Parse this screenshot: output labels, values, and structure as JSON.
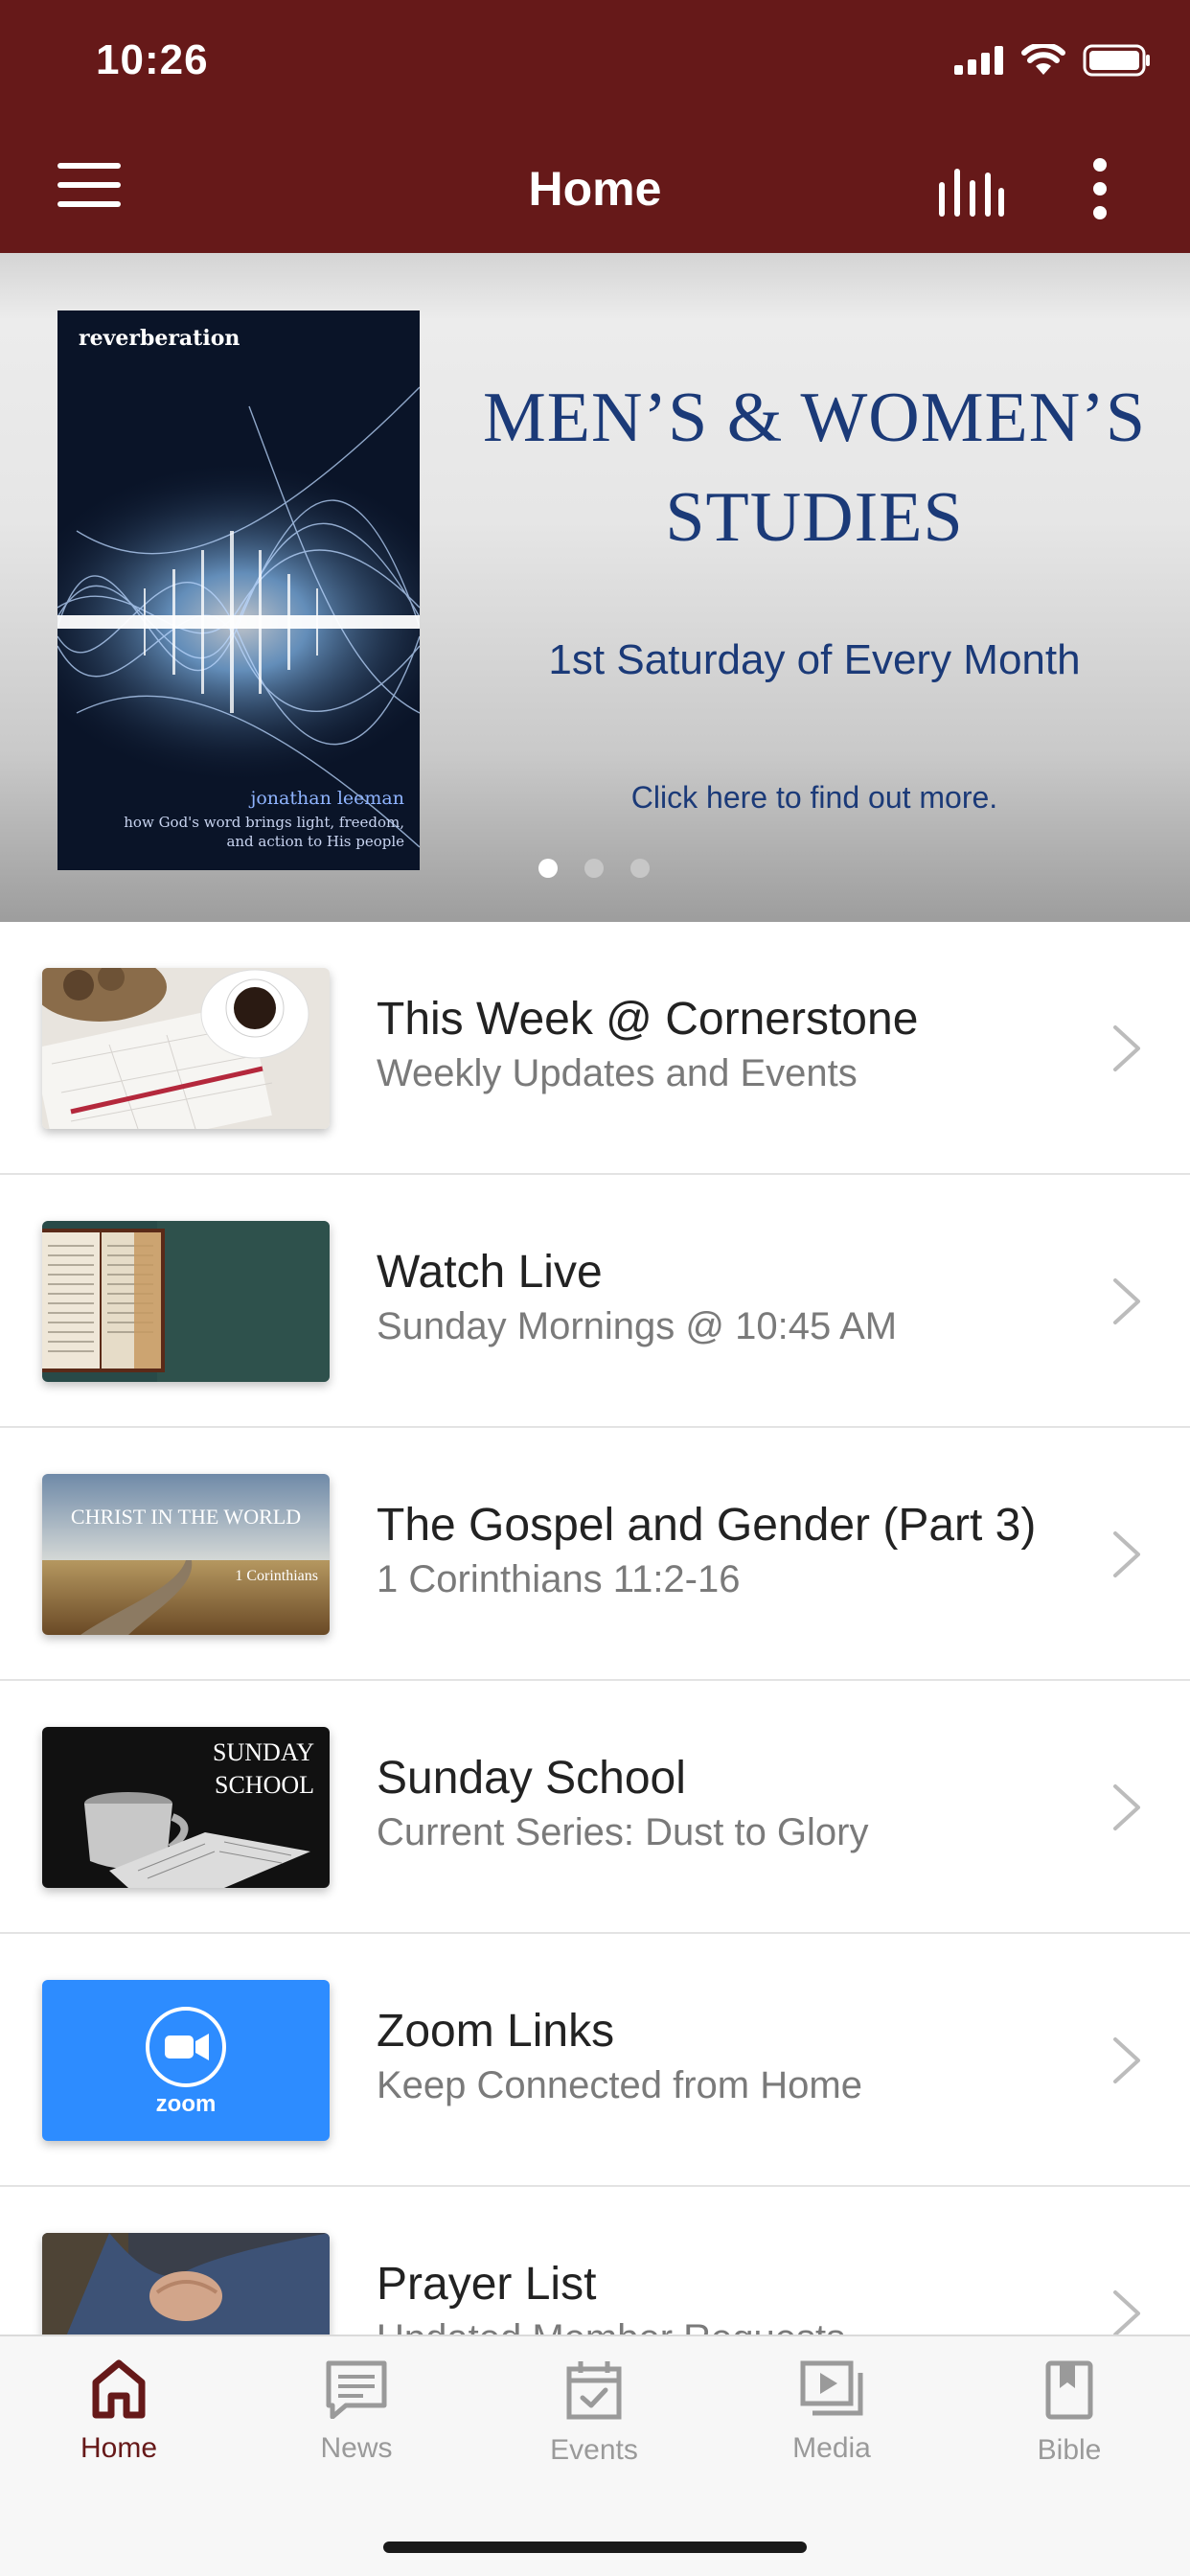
{
  "status_bar": {
    "time": "10:26"
  },
  "header": {
    "title": "Home"
  },
  "banner": {
    "book_title": "reverberation",
    "book_author": "jonathan leeman",
    "book_subtitle": "how God's word brings light, freedom, and action to His people",
    "heading_line1": "MEN’S & WOMEN’S",
    "heading_line2": "STUDIES",
    "subheading": "1st Saturday of Every Month",
    "cta": "Click here to find out more.",
    "slide_count": 3,
    "active_slide": 1
  },
  "list": {
    "items": [
      {
        "title": "This Week @ Cornerstone",
        "subtitle": "Weekly Updates and Events"
      },
      {
        "title": "Watch Live",
        "subtitle": "Sunday Mornings @ 10:45 AM"
      },
      {
        "title": "The Gospel and Gender (Part 3)",
        "subtitle": "1 Corinthians 11:2-16",
        "thumb_text": "CHRIST IN THE WORLD",
        "thumb_caption": "1 Corinthians"
      },
      {
        "title": "Sunday School",
        "subtitle": "Current Series: Dust to Glory",
        "thumb_line1": "SUNDAY",
        "thumb_line2": "SCHOOL"
      },
      {
        "title": "Zoom Links",
        "subtitle": "Keep Connected from Home",
        "thumb_text": "zoom"
      },
      {
        "title": "Prayer List",
        "subtitle": "Updated Member Requests"
      }
    ]
  },
  "tabs": [
    {
      "label": "Home",
      "icon": "home-icon",
      "active": true
    },
    {
      "label": "News",
      "icon": "news-icon"
    },
    {
      "label": "Events",
      "icon": "events-icon"
    },
    {
      "label": "Media",
      "icon": "media-icon"
    },
    {
      "label": "Bible",
      "icon": "bible-icon"
    }
  ],
  "colors": {
    "brand": "#661919",
    "banner_text": "#1b3a78",
    "zoom_blue": "#2d8cff"
  }
}
